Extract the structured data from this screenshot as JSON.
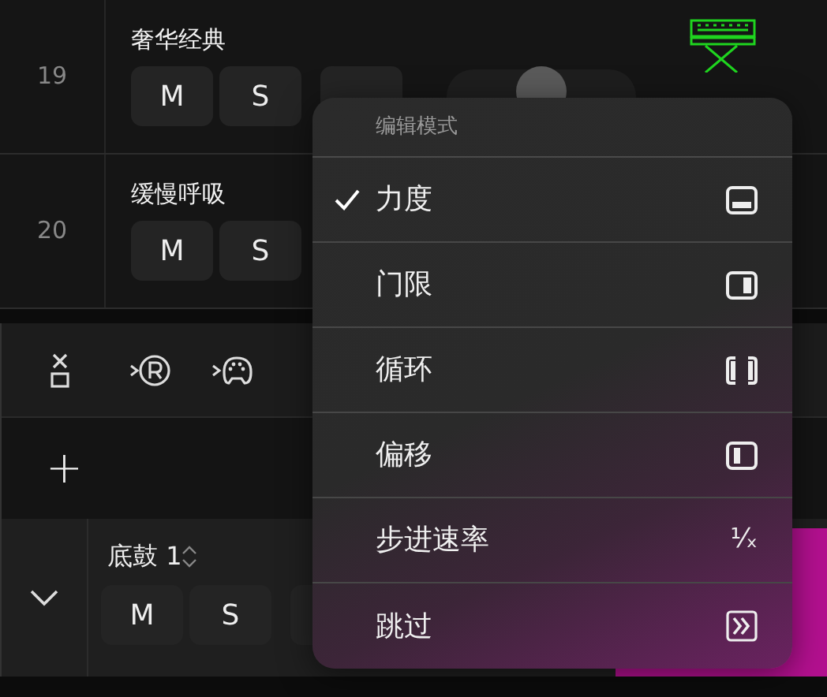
{
  "tracks": [
    {
      "number": "19",
      "name": "奢华经典",
      "buttons": [
        "M",
        "S"
      ],
      "volume": {
        "level": 0.5
      }
    },
    {
      "number": "20",
      "name": "缓慢呼吸",
      "buttons": [
        "M",
        "S"
      ]
    }
  ],
  "add_button": "+",
  "drum_track": {
    "expanded": true,
    "name": "底鼓 1",
    "buttons": [
      "M",
      "S"
    ]
  },
  "menu": {
    "title": "编辑模式",
    "items": [
      {
        "label": "力度",
        "selected": true
      },
      {
        "label": "门限",
        "selected": false
      },
      {
        "label": "循环",
        "selected": false
      },
      {
        "label": "偏移",
        "selected": false
      },
      {
        "label": "步进速率",
        "selected": false,
        "glyph": "¹⁄ₓ"
      },
      {
        "label": "跳过",
        "selected": false
      }
    ]
  }
}
